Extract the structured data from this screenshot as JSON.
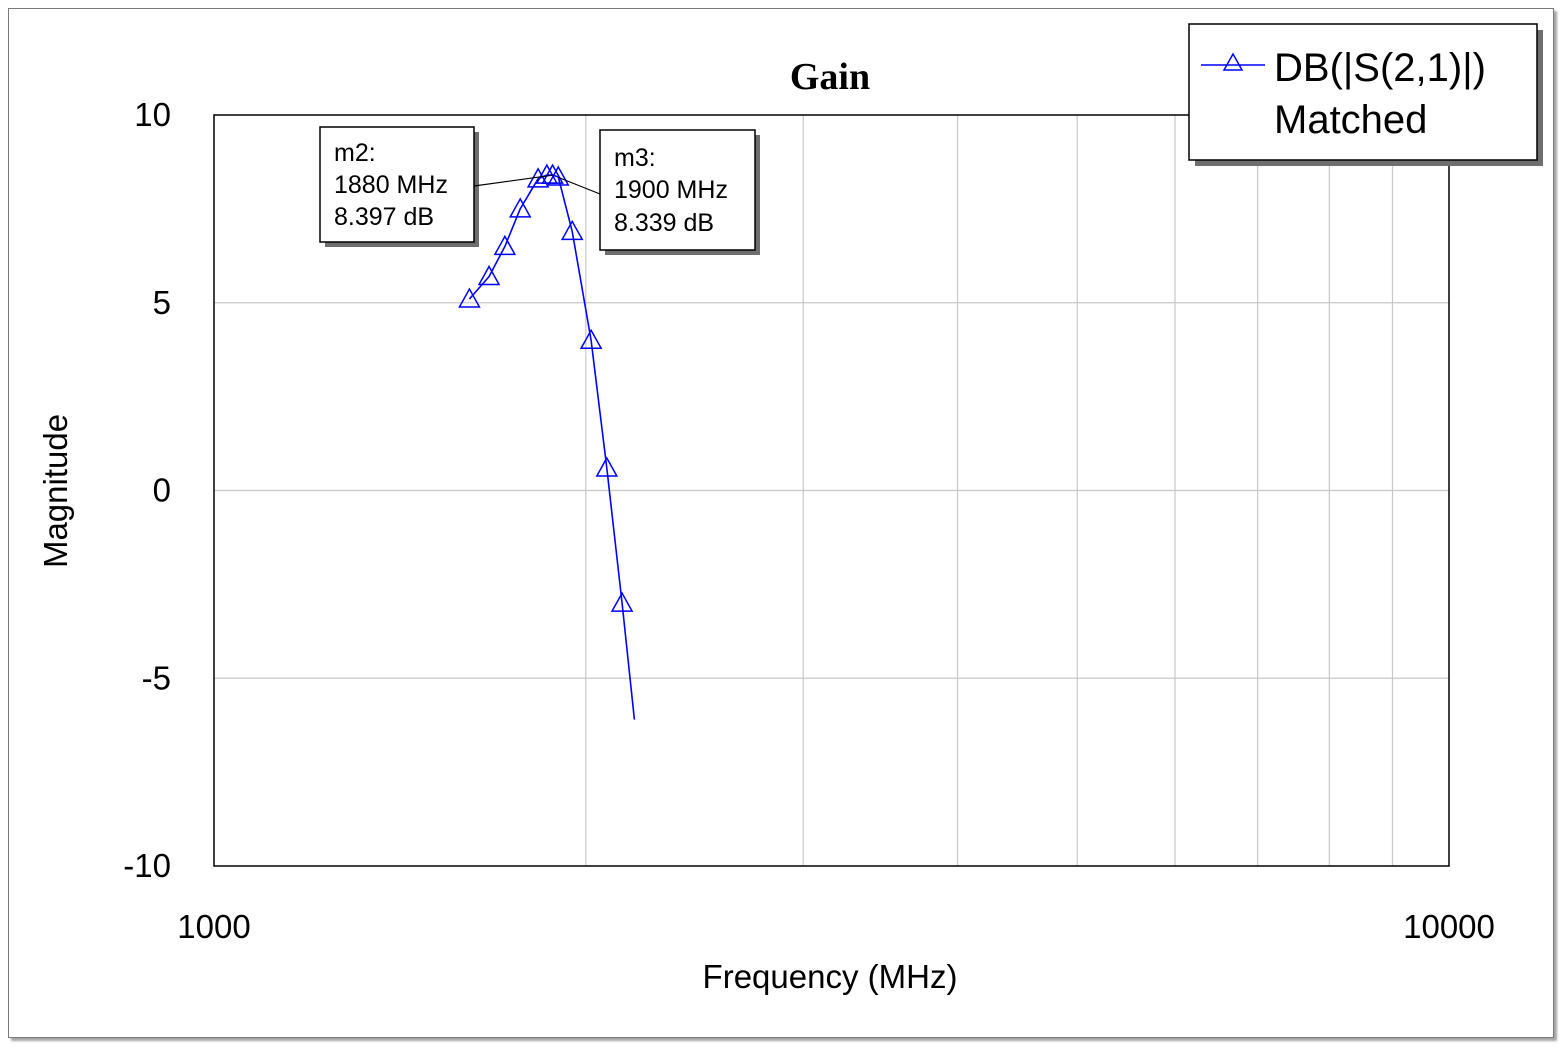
{
  "chart_data": {
    "type": "line",
    "title": "Gain",
    "xlabel": "Frequency (MHz)",
    "ylabel": "Magnitude",
    "x_scale": "log",
    "xlim": [
      1000,
      10000
    ],
    "ylim": [
      -10,
      10
    ],
    "x_tick_labels": [
      "1000",
      "10000"
    ],
    "y_ticks": [
      10,
      5,
      0,
      -5,
      -10
    ],
    "y_tick_labels": [
      "10",
      "5",
      "0",
      "-5",
      "-10"
    ],
    "grid": true,
    "legend_position": "top-right",
    "series": [
      {
        "name": "DB(|S(2,1)|)",
        "name_line2": "Matched",
        "color": "#0000ff",
        "marker": "triangle",
        "x": [
          1610,
          1670,
          1720,
          1770,
          1830,
          1860,
          1880,
          1900,
          1950,
          2020,
          2080,
          2140,
          2190
        ],
        "y": [
          5.1,
          5.7,
          6.5,
          7.5,
          8.3,
          8.4,
          8.4,
          8.35,
          6.9,
          4.0,
          0.6,
          -3.0,
          -6.1
        ],
        "marker_indices": [
          0,
          1,
          2,
          3,
          4,
          5,
          6,
          7,
          8,
          9,
          10,
          11
        ]
      }
    ],
    "markers": [
      {
        "id": "m2:",
        "freq_text": "1880 MHz",
        "value_text": "8.397 dB",
        "x": 1880,
        "y": 8.397
      },
      {
        "id": "m3:",
        "freq_text": "1900 MHz",
        "value_text": "8.339 dB",
        "x": 1900,
        "y": 8.339
      }
    ]
  }
}
